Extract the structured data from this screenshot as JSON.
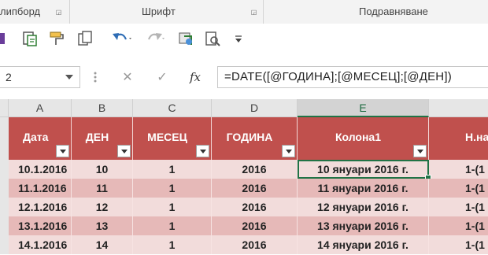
{
  "ribbon": {
    "groups": [
      "липборд",
      "Шрифт",
      "Подравняване"
    ]
  },
  "qat": {
    "icons": [
      "save-icon",
      "paste-special-icon",
      "format-painter-icon",
      "copy-icon",
      "undo-icon",
      "redo-icon",
      "macro-icon",
      "print-preview-icon",
      "customize-icon"
    ]
  },
  "formula_bar": {
    "name_box": "2",
    "cancel": "✕",
    "enter": "✓",
    "fx": "fx",
    "formula": "=DATE([@ГОДИНА];[@МЕСЕЦ];[@ДЕН])"
  },
  "columns": [
    "A",
    "B",
    "C",
    "D",
    "E",
    ""
  ],
  "table": {
    "headers": [
      "Дата",
      "ДЕН",
      "МЕСЕЦ",
      "ГОДИНА",
      "Колона1",
      "Н.на"
    ],
    "rows": [
      [
        "10.1.2016",
        "10",
        "1",
        "2016",
        "10 януари 2016 г.",
        "1-(1"
      ],
      [
        "11.1.2016",
        "11",
        "1",
        "2016",
        "11 януари 2016 г.",
        "1-(1"
      ],
      [
        "12.1.2016",
        "12",
        "1",
        "2016",
        "12 януари 2016 г.",
        "1-(1"
      ],
      [
        "13.1.2016",
        "13",
        "1",
        "2016",
        "13 януари 2016 г.",
        "1-(1"
      ],
      [
        "14.1.2016",
        "14",
        "1",
        "2016",
        "14 януари 2016 г.",
        "1-(1"
      ]
    ]
  },
  "colors": {
    "header_fill": "#c0504d",
    "row_light": "#f2dcdb",
    "row_dark": "#e6b9b8",
    "selection": "#217346"
  }
}
